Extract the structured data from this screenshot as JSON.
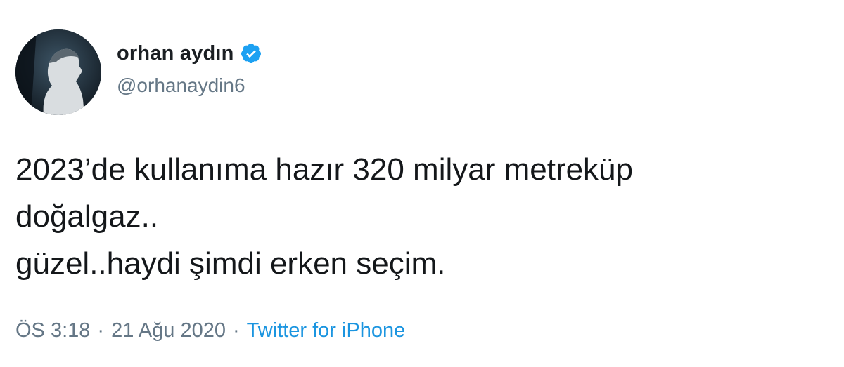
{
  "tweet": {
    "author": {
      "display_name": "orhan aydın",
      "handle": "@orhanaydin6",
      "verified_icon": "verified-badge-icon",
      "avatar_icon": "avatar-photo"
    },
    "text_lines": [
      "2023’de kullanıma hazır 320 milyar metreküp",
      "doğalgaz..",
      "güzel..haydi şimdi erken seçim."
    ],
    "meta": {
      "time": "ÖS 3:18",
      "separator": "·",
      "date": "21 Ağu 2020",
      "source": "Twitter for iPhone"
    }
  },
  "colors": {
    "text": "#14171a",
    "secondary": "#657786",
    "accent": "#1b95e0",
    "verified": "#1da1f2",
    "background": "#ffffff"
  }
}
